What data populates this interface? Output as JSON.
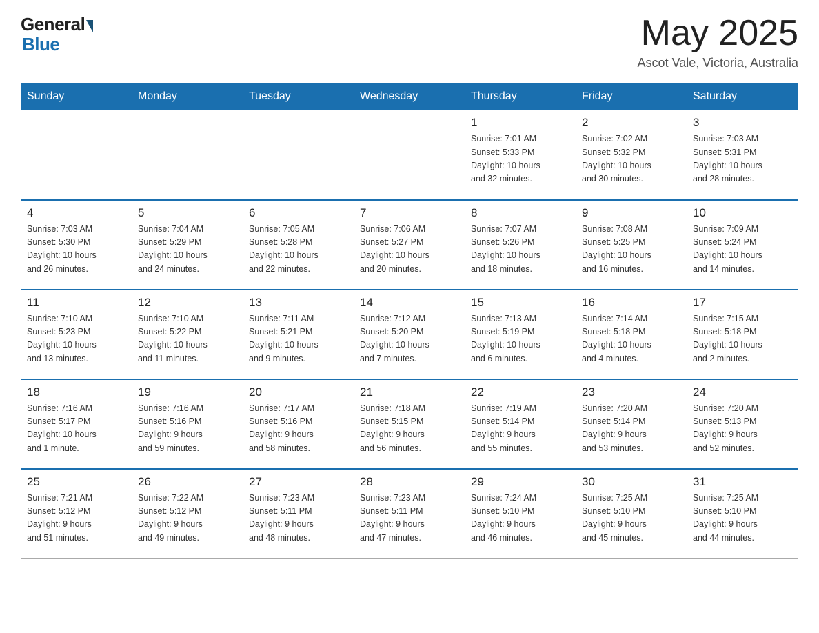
{
  "header": {
    "logo_general": "General",
    "logo_blue": "Blue",
    "month_title": "May 2025",
    "location": "Ascot Vale, Victoria, Australia"
  },
  "days_of_week": [
    "Sunday",
    "Monday",
    "Tuesday",
    "Wednesday",
    "Thursday",
    "Friday",
    "Saturday"
  ],
  "weeks": [
    [
      {
        "day": "",
        "info": ""
      },
      {
        "day": "",
        "info": ""
      },
      {
        "day": "",
        "info": ""
      },
      {
        "day": "",
        "info": ""
      },
      {
        "day": "1",
        "info": "Sunrise: 7:01 AM\nSunset: 5:33 PM\nDaylight: 10 hours\nand 32 minutes."
      },
      {
        "day": "2",
        "info": "Sunrise: 7:02 AM\nSunset: 5:32 PM\nDaylight: 10 hours\nand 30 minutes."
      },
      {
        "day": "3",
        "info": "Sunrise: 7:03 AM\nSunset: 5:31 PM\nDaylight: 10 hours\nand 28 minutes."
      }
    ],
    [
      {
        "day": "4",
        "info": "Sunrise: 7:03 AM\nSunset: 5:30 PM\nDaylight: 10 hours\nand 26 minutes."
      },
      {
        "day": "5",
        "info": "Sunrise: 7:04 AM\nSunset: 5:29 PM\nDaylight: 10 hours\nand 24 minutes."
      },
      {
        "day": "6",
        "info": "Sunrise: 7:05 AM\nSunset: 5:28 PM\nDaylight: 10 hours\nand 22 minutes."
      },
      {
        "day": "7",
        "info": "Sunrise: 7:06 AM\nSunset: 5:27 PM\nDaylight: 10 hours\nand 20 minutes."
      },
      {
        "day": "8",
        "info": "Sunrise: 7:07 AM\nSunset: 5:26 PM\nDaylight: 10 hours\nand 18 minutes."
      },
      {
        "day": "9",
        "info": "Sunrise: 7:08 AM\nSunset: 5:25 PM\nDaylight: 10 hours\nand 16 minutes."
      },
      {
        "day": "10",
        "info": "Sunrise: 7:09 AM\nSunset: 5:24 PM\nDaylight: 10 hours\nand 14 minutes."
      }
    ],
    [
      {
        "day": "11",
        "info": "Sunrise: 7:10 AM\nSunset: 5:23 PM\nDaylight: 10 hours\nand 13 minutes."
      },
      {
        "day": "12",
        "info": "Sunrise: 7:10 AM\nSunset: 5:22 PM\nDaylight: 10 hours\nand 11 minutes."
      },
      {
        "day": "13",
        "info": "Sunrise: 7:11 AM\nSunset: 5:21 PM\nDaylight: 10 hours\nand 9 minutes."
      },
      {
        "day": "14",
        "info": "Sunrise: 7:12 AM\nSunset: 5:20 PM\nDaylight: 10 hours\nand 7 minutes."
      },
      {
        "day": "15",
        "info": "Sunrise: 7:13 AM\nSunset: 5:19 PM\nDaylight: 10 hours\nand 6 minutes."
      },
      {
        "day": "16",
        "info": "Sunrise: 7:14 AM\nSunset: 5:18 PM\nDaylight: 10 hours\nand 4 minutes."
      },
      {
        "day": "17",
        "info": "Sunrise: 7:15 AM\nSunset: 5:18 PM\nDaylight: 10 hours\nand 2 minutes."
      }
    ],
    [
      {
        "day": "18",
        "info": "Sunrise: 7:16 AM\nSunset: 5:17 PM\nDaylight: 10 hours\nand 1 minute."
      },
      {
        "day": "19",
        "info": "Sunrise: 7:16 AM\nSunset: 5:16 PM\nDaylight: 9 hours\nand 59 minutes."
      },
      {
        "day": "20",
        "info": "Sunrise: 7:17 AM\nSunset: 5:16 PM\nDaylight: 9 hours\nand 58 minutes."
      },
      {
        "day": "21",
        "info": "Sunrise: 7:18 AM\nSunset: 5:15 PM\nDaylight: 9 hours\nand 56 minutes."
      },
      {
        "day": "22",
        "info": "Sunrise: 7:19 AM\nSunset: 5:14 PM\nDaylight: 9 hours\nand 55 minutes."
      },
      {
        "day": "23",
        "info": "Sunrise: 7:20 AM\nSunset: 5:14 PM\nDaylight: 9 hours\nand 53 minutes."
      },
      {
        "day": "24",
        "info": "Sunrise: 7:20 AM\nSunset: 5:13 PM\nDaylight: 9 hours\nand 52 minutes."
      }
    ],
    [
      {
        "day": "25",
        "info": "Sunrise: 7:21 AM\nSunset: 5:12 PM\nDaylight: 9 hours\nand 51 minutes."
      },
      {
        "day": "26",
        "info": "Sunrise: 7:22 AM\nSunset: 5:12 PM\nDaylight: 9 hours\nand 49 minutes."
      },
      {
        "day": "27",
        "info": "Sunrise: 7:23 AM\nSunset: 5:11 PM\nDaylight: 9 hours\nand 48 minutes."
      },
      {
        "day": "28",
        "info": "Sunrise: 7:23 AM\nSunset: 5:11 PM\nDaylight: 9 hours\nand 47 minutes."
      },
      {
        "day": "29",
        "info": "Sunrise: 7:24 AM\nSunset: 5:10 PM\nDaylight: 9 hours\nand 46 minutes."
      },
      {
        "day": "30",
        "info": "Sunrise: 7:25 AM\nSunset: 5:10 PM\nDaylight: 9 hours\nand 45 minutes."
      },
      {
        "day": "31",
        "info": "Sunrise: 7:25 AM\nSunset: 5:10 PM\nDaylight: 9 hours\nand 44 minutes."
      }
    ]
  ]
}
